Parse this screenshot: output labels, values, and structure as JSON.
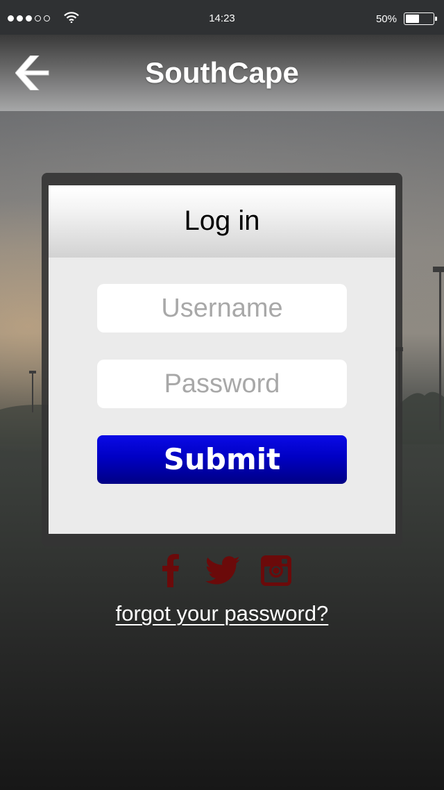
{
  "status_bar": {
    "time": "14:23",
    "battery_text": "50%",
    "battery_level": 0.5,
    "signal_bars_filled": 3,
    "signal_bars_total": 5
  },
  "nav": {
    "back_icon": "chevron-left-icon",
    "title": "SouthCape"
  },
  "login": {
    "title": "Log in",
    "username_placeholder": "Username",
    "username_value": "",
    "password_placeholder": "Password",
    "password_value": "",
    "submit_label": "Submit"
  },
  "social": {
    "icons": [
      "facebook-icon",
      "twitter-icon",
      "instagram-icon"
    ],
    "icon_color": "#6b0a0a"
  },
  "forgot_password": "forgot your password?",
  "colors": {
    "submit_button": "#0000c4",
    "nav_title": "#ffffff"
  }
}
